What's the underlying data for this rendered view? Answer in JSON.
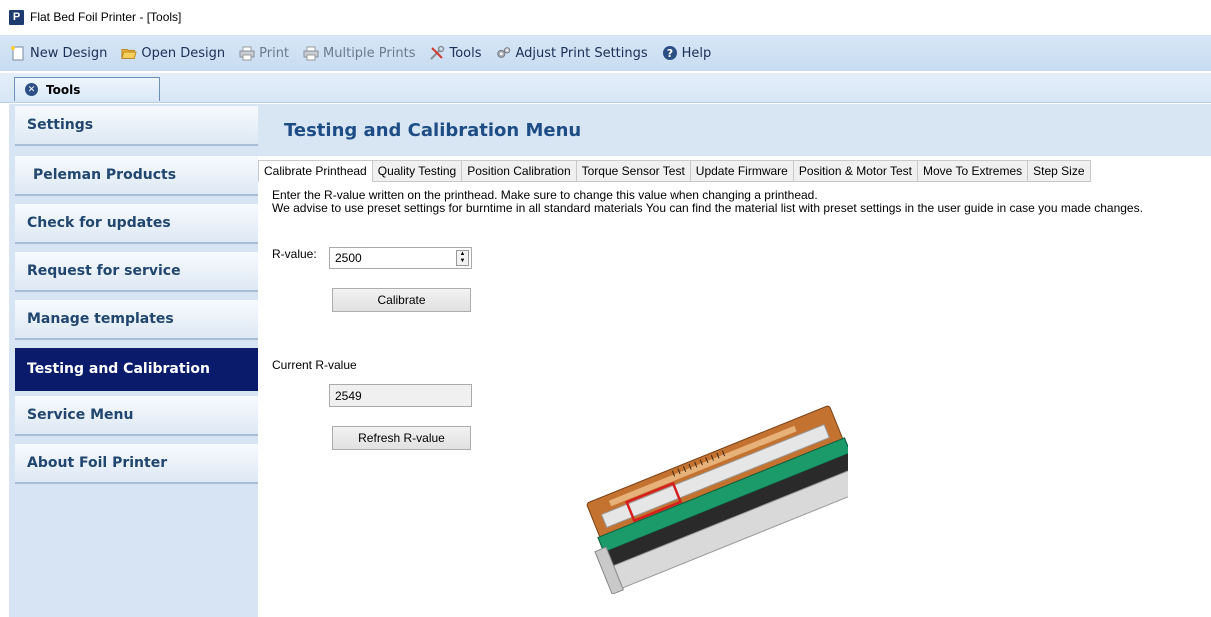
{
  "window": {
    "title": "Flat Bed Foil Printer - [Tools]",
    "app_icon_letter": "P"
  },
  "toolbar": {
    "items": [
      {
        "label": "New Design",
        "icon": "new-design-icon"
      },
      {
        "label": "Open Design",
        "icon": "open-folder-icon"
      },
      {
        "label": "Print",
        "icon": "printer-icon"
      },
      {
        "label": "Multiple Prints",
        "icon": "multiple-printer-icon"
      },
      {
        "label": "Tools",
        "icon": "tools-icon"
      },
      {
        "label": "Adjust Print Settings",
        "icon": "settings-gears-icon"
      },
      {
        "label": "Help",
        "icon": "help-icon"
      }
    ]
  },
  "doc_tab": {
    "label": "Tools"
  },
  "sidebar": {
    "items": [
      {
        "label": "Settings"
      },
      {
        "label": "Peleman Products"
      },
      {
        "label": "Check for updates"
      },
      {
        "label": "Request for service"
      },
      {
        "label": "Manage templates"
      },
      {
        "label": "Testing and Calibration",
        "active": true
      },
      {
        "label": "Service Menu"
      },
      {
        "label": "About Foil Printer"
      }
    ]
  },
  "main": {
    "title": "Testing and Calibration Menu",
    "tabs": [
      {
        "label": "Calibrate Printhead",
        "active": true
      },
      {
        "label": "Quality Testing"
      },
      {
        "label": "Position Calibration"
      },
      {
        "label": "Torque Sensor Test"
      },
      {
        "label": "Update Firmware"
      },
      {
        "label": "Position & Motor Test"
      },
      {
        "label": "Move To Extremes"
      },
      {
        "label": "Step Size"
      }
    ],
    "instructions": {
      "line1": "Enter the R-value written on the printhead. Make sure to change this value when changing a printhead.",
      "line2": "We advise to use preset settings for burntime in all standard materials You can find the material list with preset settings in the user guide in case you made changes."
    },
    "rvalue_label": "R-value:",
    "rvalue_input": "2500",
    "calibrate_button": "Calibrate",
    "current_label": "Current R-value",
    "current_value": "2549",
    "refresh_button": "Refresh R-value"
  },
  "colors": {
    "toolbar_bg": "#c8dcf1",
    "sidebar_active": "#0a1b6b",
    "title_blue": "#1e4d86"
  }
}
